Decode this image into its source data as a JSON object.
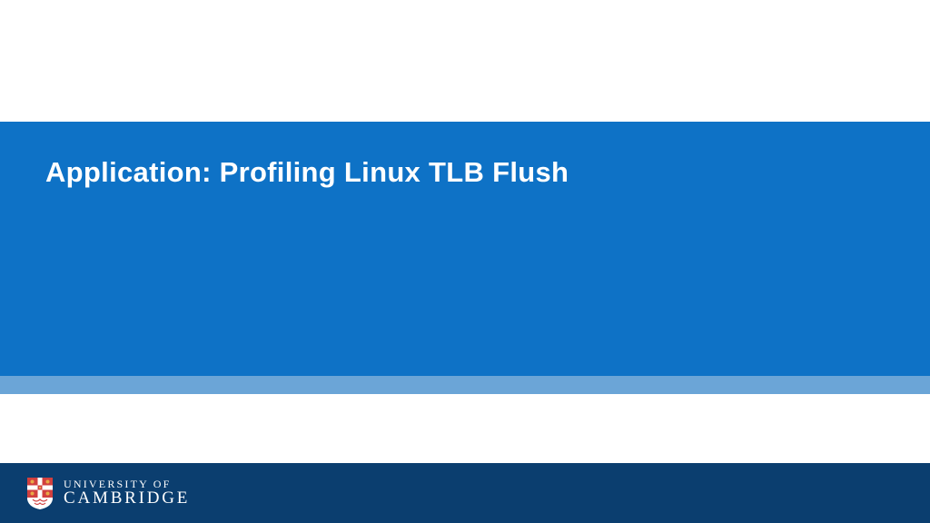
{
  "slide": {
    "title": "Application: Profiling Linux TLB Flush"
  },
  "footer": {
    "institution_line1": "UNIVERSITY OF",
    "institution_line2": "CAMBRIDGE"
  },
  "colors": {
    "main_blue": "#0e72c6",
    "accent_blue": "#6ba5d7",
    "footer_blue": "#0b3e6f",
    "crest_red": "#d1403f",
    "crest_gold": "#e9a947"
  }
}
